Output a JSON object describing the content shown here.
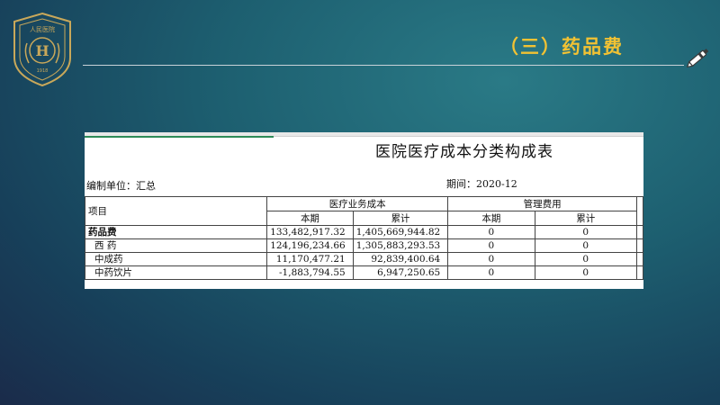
{
  "slide": {
    "title": "（三）药品费"
  },
  "logo": {
    "text": "人民医院",
    "year": "1918"
  },
  "report": {
    "title": "医院医疗成本分类构成表",
    "unit_label": "编制单位：汇总",
    "period_label": "期间：2020-12",
    "header_item": "项目",
    "group_medical": "医疗业务成本",
    "group_admin": "管理费用",
    "col_current": "本期",
    "col_cumulative": "累计",
    "rows": [
      {
        "name": "药品费",
        "bold": true,
        "m_current": "133,482,917.32",
        "m_cum": "1,405,669,944.82",
        "a_current": "0",
        "a_cum": "0"
      },
      {
        "name": "西 药",
        "bold": false,
        "m_current": "124,196,234.66",
        "m_cum": "1,305,883,293.53",
        "a_current": "0",
        "a_cum": "0"
      },
      {
        "name": "中成药",
        "bold": false,
        "m_current": "11,170,477.21",
        "m_cum": "92,839,400.64",
        "a_current": "0",
        "a_cum": "0"
      },
      {
        "name": "中药饮片",
        "bold": false,
        "m_current": "-1,883,794.55",
        "m_cum": "6,947,250.65",
        "a_current": "0",
        "a_cum": "0"
      }
    ]
  }
}
